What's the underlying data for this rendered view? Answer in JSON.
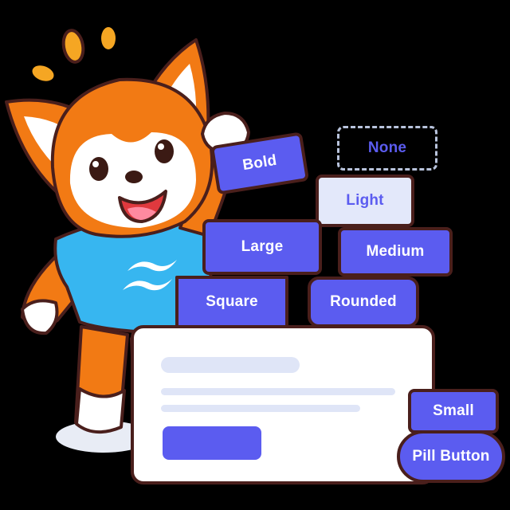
{
  "blocks": {
    "bold": "Bold",
    "none": "None",
    "light": "Light",
    "large": "Large",
    "medium": "Medium",
    "square": "Square",
    "rounded": "Rounded",
    "small": "Small",
    "pill": "Pill Button"
  },
  "colors": {
    "background": "#000000",
    "fox_orange": "#f27a14",
    "outline": "#4a1f1c",
    "shirt": "#37b6f0",
    "block_indigo": "#5b5cf0",
    "block_light": "#e3e8fa",
    "card_bar": "#dfe5f7"
  },
  "icons": {
    "mascot": "fox-mascot-icon",
    "shirt_logo": "wind-wave-icon"
  }
}
